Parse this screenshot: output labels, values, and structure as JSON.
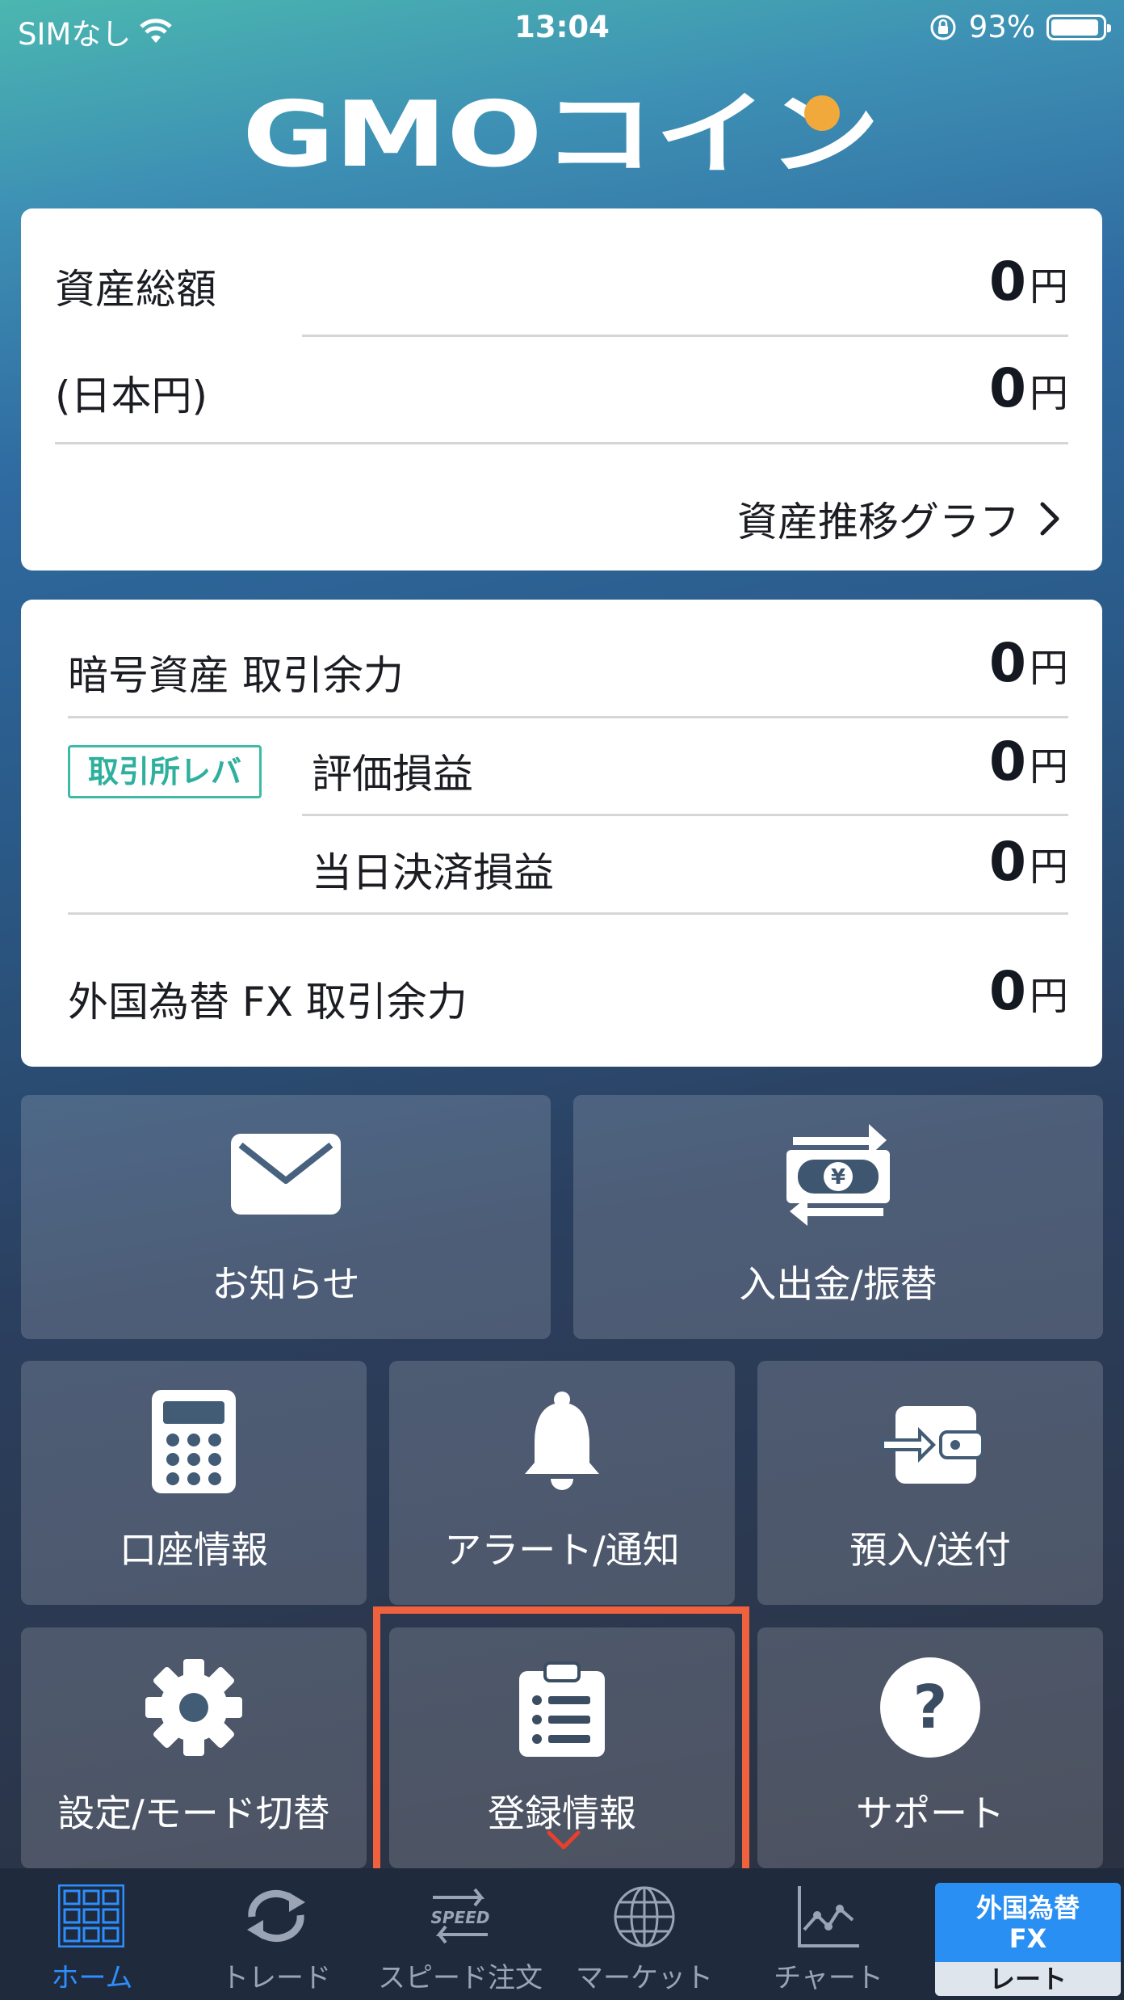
{
  "status_bar": {
    "carrier": "SIMなし",
    "time": "13:04",
    "battery": "93%"
  },
  "logo": {
    "text": "GMOコイン",
    "accent": "#f2a93b"
  },
  "assets_card": {
    "total_label": "資産総額",
    "total_value": "0",
    "jpy_label": "(日本円)",
    "jpy_value": "0",
    "unit": "円",
    "graph_link": "資産推移グラフ"
  },
  "trade_card": {
    "crypto_label": "暗号資産 取引余力",
    "crypto_value": "0",
    "badge": "取引所レバ",
    "eval_label": "評価損益",
    "eval_value": "0",
    "settle_label": "当日決済損益",
    "settle_value": "0",
    "fx_label": "外国為替 FX 取引余力",
    "fx_value": "0",
    "unit": "円"
  },
  "tiles": {
    "news": "お知らせ",
    "deposit": "入出金/振替",
    "account": "口座情報",
    "alert": "アラート/通知",
    "transfer": "預入/送付",
    "settings": "設定/モード切替",
    "registration": "登録情報",
    "support": "サポート"
  },
  "tabbar": {
    "home": "ホーム",
    "trade": "トレード",
    "speed": "スピード注文",
    "speed_icon_text": "SPEED",
    "market": "マーケット",
    "chart": "チャート",
    "fx_top": "外国為替",
    "fx_mid": "FX",
    "fx_rate": "レート"
  },
  "colors": {
    "accent_teal": "#3fbaa8",
    "highlight": "#f0613e",
    "tab_active": "#2d8fff"
  }
}
